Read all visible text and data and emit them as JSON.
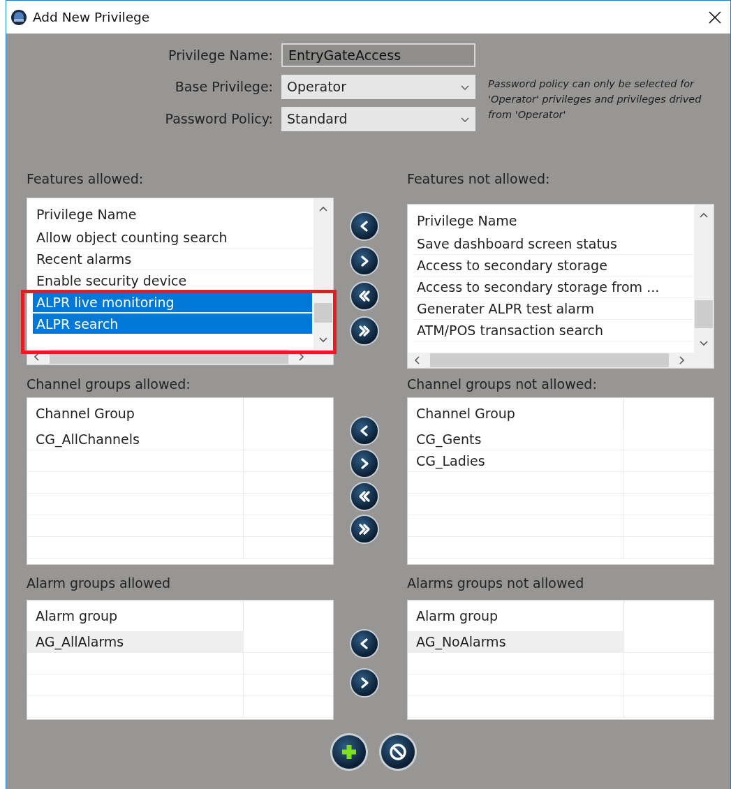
{
  "window": {
    "title": "Add New Privilege"
  },
  "form": {
    "privilege_name": {
      "label": "Privilege Name:",
      "value": "EntryGateAccess",
      "disabled": true
    },
    "base_privilege": {
      "label": "Base Privilege:",
      "value": "Operator"
    },
    "password_policy": {
      "label": "Password Policy:",
      "value": "Standard"
    },
    "note": "Password policy can only be selected for 'Operator' privileges and privileges drived from 'Operator'"
  },
  "features_allowed": {
    "title": "Features allowed:",
    "column": "Privilege Name",
    "highlighted": true,
    "rows": [
      {
        "label": "Allow object counting search",
        "selected": false
      },
      {
        "label": "Recent alarms",
        "selected": false
      },
      {
        "label": "Enable security device",
        "selected": false
      },
      {
        "label": "ALPR live monitoring",
        "selected": true
      },
      {
        "label": "ALPR search",
        "selected": true
      }
    ]
  },
  "features_not_allowed": {
    "title": "Features not allowed:",
    "column": "Privilege Name",
    "rows": [
      {
        "label": "Save dashboard screen status",
        "selected": false
      },
      {
        "label": "Access to secondary storage",
        "selected": false
      },
      {
        "label": "Access to secondary storage from ...",
        "selected": false
      },
      {
        "label": "Generater ALPR test alarm",
        "selected": false
      },
      {
        "label": "ATM/POS transaction search",
        "selected": false
      }
    ]
  },
  "feature_buttons": [
    {
      "kind": "move-left"
    },
    {
      "kind": "move-right"
    },
    {
      "kind": "move-all-left"
    },
    {
      "kind": "move-all-right"
    }
  ],
  "channel_groups_allowed": {
    "title": "Channel groups allowed:",
    "columns": [
      "Channel Group"
    ],
    "rows": [
      {
        "label": "CG_AllChannels",
        "selected": false
      }
    ]
  },
  "channel_groups_not_allowed": {
    "title": "Channel groups not allowed:",
    "columns": [
      "Channel Group"
    ],
    "rows": [
      {
        "label": "CG_Gents",
        "selected": false
      },
      {
        "label": "CG_Ladies",
        "selected": false
      }
    ]
  },
  "channel_buttons": [
    {
      "kind": "move-left"
    },
    {
      "kind": "move-right"
    },
    {
      "kind": "move-all-left"
    },
    {
      "kind": "move-all-right"
    }
  ],
  "alarm_groups_allowed": {
    "title": "Alarm groups allowed",
    "columns": [
      "Alarm group"
    ],
    "rows": [
      {
        "label": "AG_AllAlarms",
        "selected": true
      }
    ]
  },
  "alarm_groups_not_allowed": {
    "title": "Alarms groups not allowed",
    "columns": [
      "Alarm group"
    ],
    "rows": [
      {
        "label": "AG_NoAlarms",
        "selected": true
      }
    ]
  },
  "alarm_buttons": [
    {
      "kind": "move-left"
    },
    {
      "kind": "move-right"
    }
  ],
  "actions": [
    {
      "kind": "add"
    },
    {
      "kind": "cancel"
    }
  ]
}
